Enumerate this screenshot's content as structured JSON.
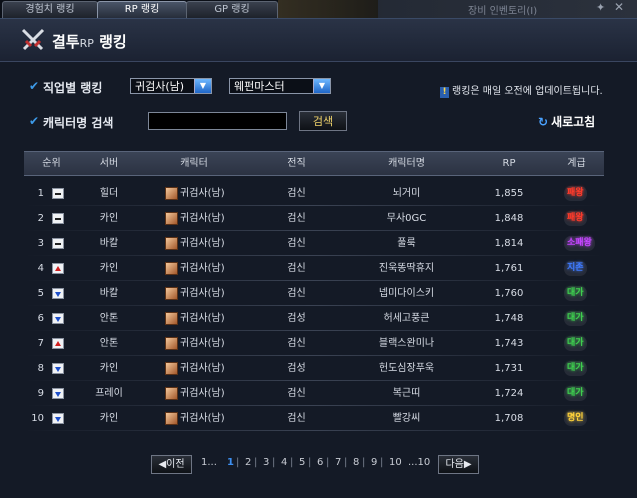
{
  "tabs": [
    {
      "label": "경험치 랭킹",
      "active": false
    },
    {
      "label": "RP 랭킹",
      "active": true
    },
    {
      "label": "GP 랭킹",
      "active": false
    }
  ],
  "background_window": {
    "label": "장비 인벤토리(I)"
  },
  "header": {
    "title_prefix": "결투",
    "title_rp": "RP",
    "title_suffix": " 랭킹"
  },
  "filters": {
    "job_label": "직업별 랭킹",
    "job_select": "귀검사(남)",
    "subjob_select": "웨펀마스터",
    "notice": "랭킹은 매일 오전에 업데이트됩니다.",
    "name_label": "캐릭터명 검색",
    "search_value": "",
    "search_button": "검색",
    "refresh": "새로고침"
  },
  "table": {
    "columns": [
      "순위",
      "서버",
      "캐릭터",
      "전직",
      "캐릭터명",
      "RP",
      "계급"
    ],
    "rows": [
      {
        "rank": "1",
        "change": "same",
        "server": "힐더",
        "job": "귀검사(남)",
        "advance": "검신",
        "name": "뇌거미",
        "rp": "1,855",
        "grade": "패왕",
        "grade_color": "#ff3b2b"
      },
      {
        "rank": "2",
        "change": "same",
        "server": "카인",
        "job": "귀검사(남)",
        "advance": "검신",
        "name": "무사0GC",
        "rp": "1,848",
        "grade": "패왕",
        "grade_color": "#ff3b2b"
      },
      {
        "rank": "3",
        "change": "same",
        "server": "바칼",
        "job": "귀검사(남)",
        "advance": "검신",
        "name": "풀룩",
        "rp": "1,814",
        "grade": "소패왕",
        "grade_color": "#c445ff"
      },
      {
        "rank": "4",
        "change": "up",
        "server": "카인",
        "job": "귀검사(남)",
        "advance": "검신",
        "name": "진욱똥딱휴지",
        "rp": "1,761",
        "grade": "지존",
        "grade_color": "#3f7bff"
      },
      {
        "rank": "5",
        "change": "down",
        "server": "바칼",
        "job": "귀검사(남)",
        "advance": "검신",
        "name": "넵미다이스키",
        "rp": "1,760",
        "grade": "대가",
        "grade_color": "#3fcf4f"
      },
      {
        "rank": "6",
        "change": "down",
        "server": "안톤",
        "job": "귀검사(남)",
        "advance": "검성",
        "name": "허세고풍큰",
        "rp": "1,748",
        "grade": "대가",
        "grade_color": "#3fcf4f"
      },
      {
        "rank": "7",
        "change": "up",
        "server": "안톤",
        "job": "귀검사(남)",
        "advance": "검신",
        "name": "블랙스완미나",
        "rp": "1,743",
        "grade": "대가",
        "grade_color": "#3fcf4f"
      },
      {
        "rank": "8",
        "change": "down",
        "server": "카인",
        "job": "귀검사(남)",
        "advance": "검성",
        "name": "헌도심장푸욱",
        "rp": "1,731",
        "grade": "대가",
        "grade_color": "#3fcf4f"
      },
      {
        "rank": "9",
        "change": "down",
        "server": "프레이",
        "job": "귀검사(남)",
        "advance": "검신",
        "name": "복근띠",
        "rp": "1,724",
        "grade": "대가",
        "grade_color": "#3fcf4f"
      },
      {
        "rank": "10",
        "change": "down",
        "server": "카인",
        "job": "귀검사(남)",
        "advance": "검신",
        "name": "빨강씨",
        "rp": "1,708",
        "grade": "명인",
        "grade_color": "#ffd23a"
      }
    ]
  },
  "pagination": {
    "prev": "이전",
    "next": "다음",
    "first": "1...",
    "pages": [
      "1",
      "2",
      "3",
      "4",
      "5",
      "6",
      "7",
      "8",
      "9",
      "10"
    ],
    "current": "1",
    "last": "...10"
  }
}
